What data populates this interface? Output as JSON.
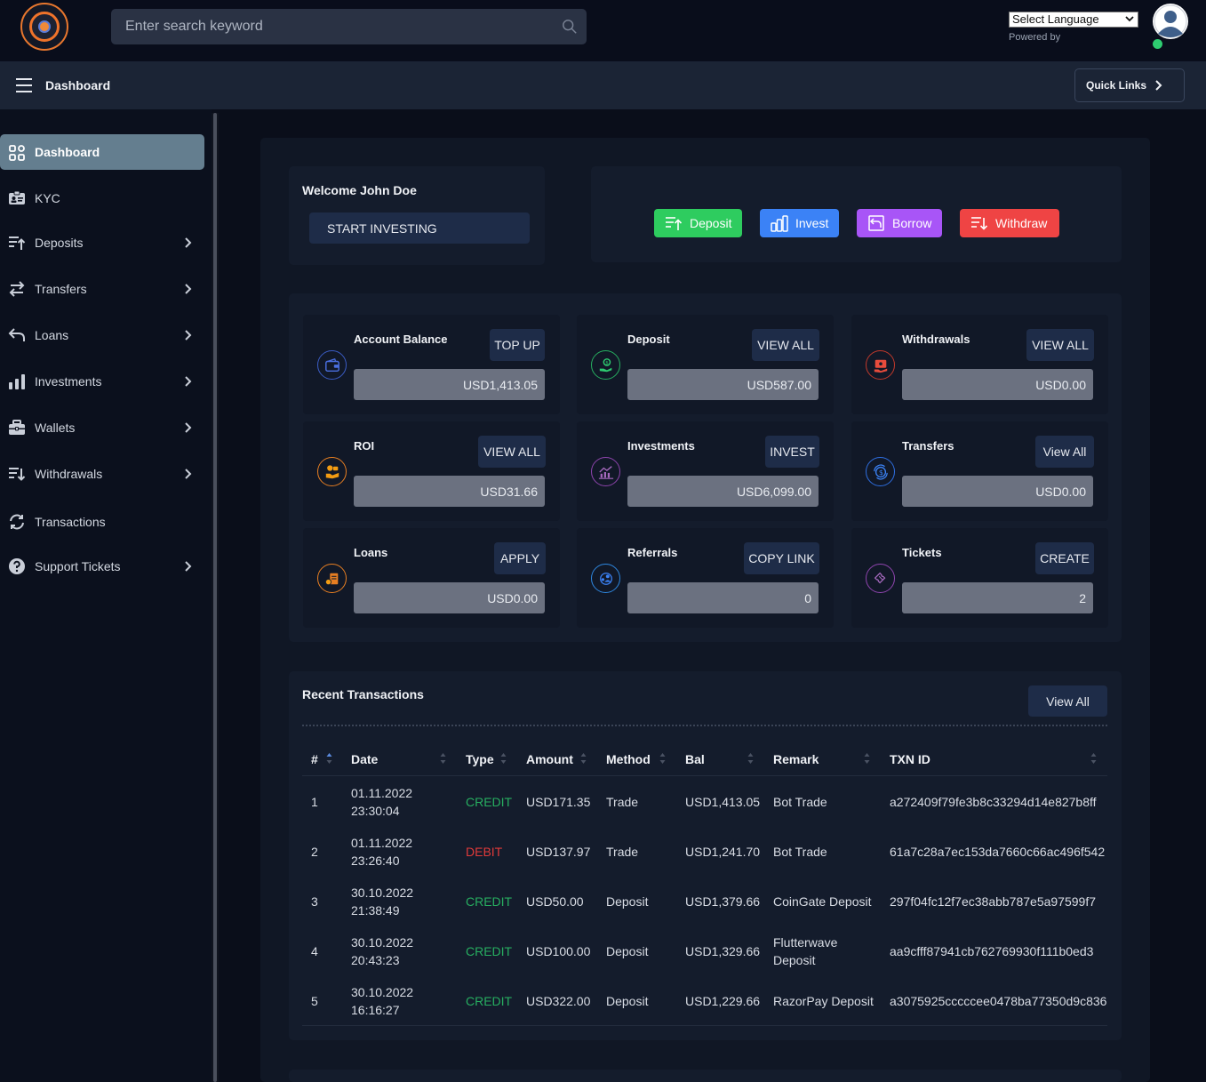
{
  "topbar": {
    "search_placeholder": "Enter search keyword",
    "language_select": "Select Language",
    "powered_by": "Powered by"
  },
  "header": {
    "title": "Dashboard",
    "quick_links": "Quick Links"
  },
  "sidebar": {
    "items": [
      {
        "label": "Dashboard",
        "icon": "grid-icon",
        "active": true
      },
      {
        "label": "KYC",
        "icon": "id-card-icon"
      },
      {
        "label": "Deposits",
        "icon": "deposit-icon"
      },
      {
        "label": "Transfers",
        "icon": "transfer-arrows-icon"
      },
      {
        "label": "Loans",
        "icon": "reply-arrow-icon"
      },
      {
        "label": "Investments",
        "icon": "bar-chart-icon"
      },
      {
        "label": "Wallets",
        "icon": "briefcase-icon"
      },
      {
        "label": "Withdrawals",
        "icon": "withdraw-icon"
      },
      {
        "label": "Transactions",
        "icon": "refresh-icon"
      },
      {
        "label": "Support Tickets",
        "icon": "question-icon"
      }
    ]
  },
  "welcome": {
    "title": "Welcome John Doe",
    "start_button": "START INVESTING"
  },
  "actions": {
    "deposit": "Deposit",
    "invest": "Invest",
    "borrow": "Borrow",
    "withdraw": "Withdraw",
    "colors": {
      "deposit": "#2ecc5f",
      "invest": "#3b82f6",
      "borrow": "#a855f7",
      "withdraw": "#ef4444"
    }
  },
  "stats": {
    "account_balance": {
      "title": "Account Balance",
      "button": "TOP UP",
      "value": "USD1,413.05"
    },
    "deposit": {
      "title": "Deposit",
      "button": "VIEW ALL",
      "value": "USD587.00"
    },
    "withdrawals": {
      "title": "Withdrawals",
      "button": "VIEW ALL",
      "value": "USD0.00"
    },
    "roi": {
      "title": "ROI",
      "button": "VIEW ALL",
      "value": "USD31.66"
    },
    "investments": {
      "title": "Investments",
      "button": "INVEST",
      "value": "USD6,099.00"
    },
    "transfers": {
      "title": "Transfers",
      "button": "View All",
      "value": "USD0.00"
    },
    "loans": {
      "title": "Loans",
      "button": "APPLY",
      "value": "USD0.00"
    },
    "referrals": {
      "title": "Referrals",
      "button": "COPY LINK",
      "value": "0"
    },
    "tickets": {
      "title": "Tickets",
      "button": "CREATE",
      "value": "2"
    }
  },
  "recent_transactions": {
    "title": "Recent Transactions",
    "view_all": "View All",
    "columns": [
      "#",
      "Date",
      "Type",
      "Amount",
      "Method",
      "Bal",
      "Remark",
      "TXN ID"
    ],
    "rows": [
      {
        "n": "1",
        "date": "01.11.2022",
        "time": "23:30:04",
        "type": "CREDIT",
        "amount": "USD171.35",
        "method": "Trade",
        "bal": "USD1,413.05",
        "remark": "Bot Trade",
        "remark2": "",
        "txn": "a272409f79fe3b8c33294d14e827b8ff"
      },
      {
        "n": "2",
        "date": "01.11.2022",
        "time": "23:26:40",
        "type": "DEBIT",
        "amount": "USD137.97",
        "method": "Trade",
        "bal": "USD1,241.70",
        "remark": "Bot Trade",
        "remark2": "",
        "txn": "61a7c28a7ec153da7660c66ac496f542"
      },
      {
        "n": "3",
        "date": "30.10.2022",
        "time": "21:38:49",
        "type": "CREDIT",
        "amount": "USD50.00",
        "method": "Deposit",
        "bal": "USD1,379.66",
        "remark": "CoinGate Deposit",
        "remark2": "",
        "txn": "297f04fc12f7ec38abb787e5a97599f7"
      },
      {
        "n": "4",
        "date": "30.10.2022",
        "time": "20:43:23",
        "type": "CREDIT",
        "amount": "USD100.00",
        "method": "Deposit",
        "bal": "USD1,329.66",
        "remark": "Flutterwave",
        "remark2": "Deposit",
        "txn": "aa9cfff87941cb762769930f111b0ed3"
      },
      {
        "n": "5",
        "date": "30.10.2022",
        "time": "16:16:27",
        "type": "CREDIT",
        "amount": "USD322.00",
        "method": "Deposit",
        "bal": "USD1,229.66",
        "remark": "RazorPay Deposit",
        "remark2": "",
        "txn": "a3075925cccccee0478ba77350d9c836"
      }
    ]
  }
}
